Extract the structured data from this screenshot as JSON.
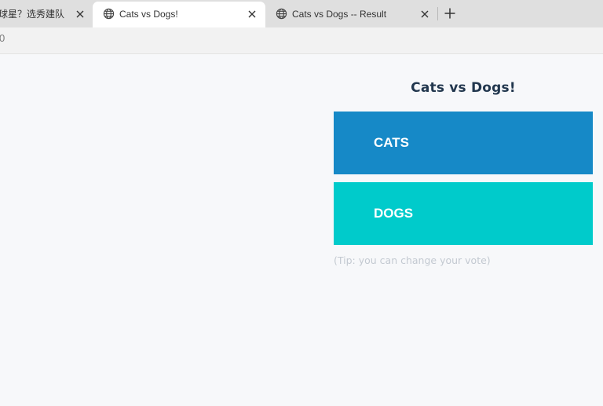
{
  "browser": {
    "tabs": [
      {
        "title": "球星？选秀建队",
        "active": false
      },
      {
        "title": "Cats vs Dogs!",
        "active": true
      },
      {
        "title": "Cats vs Dogs -- Result",
        "active": false
      }
    ],
    "address_text": "0",
    "icons": {
      "tab_favicon": "globe-icon",
      "tab_close": "close-icon",
      "new_tab": "plus-icon"
    }
  },
  "page": {
    "title": "Cats vs Dogs!",
    "options": [
      {
        "label": "CATS",
        "color": "#1689c7"
      },
      {
        "label": "DOGS",
        "color": "#00cbcb"
      }
    ],
    "tip": "(Tip: you can change your vote)"
  }
}
